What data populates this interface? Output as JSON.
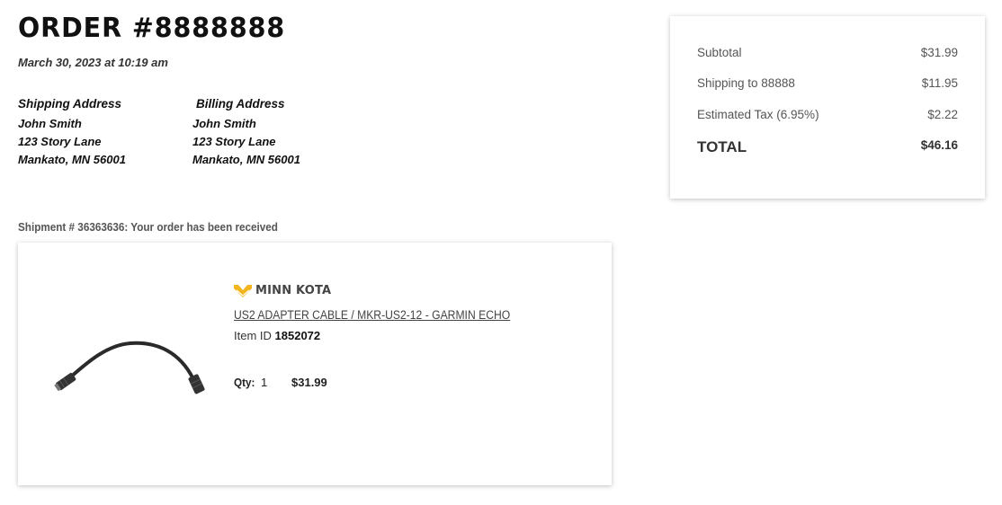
{
  "order": {
    "title": "ORDER #8888888",
    "date": "March 30, 2023 at 10:19 am"
  },
  "shipping_address": {
    "heading": "Shipping Address",
    "name": "John Smith",
    "street": "123 Story Lane",
    "city_state_zip": "Mankato, MN 56001"
  },
  "billing_address": {
    "heading": "Billing Address",
    "name": "John Smith",
    "street": "123 Story Lane",
    "city_state_zip": "Mankato, MN 56001"
  },
  "shipment": {
    "status_text": "Shipment # 36363636: Your order has been received",
    "item": {
      "brand": "MINN KOTA",
      "name": "US2 ADAPTER CABLE / MKR-US2-12 - GARMIN ECHO",
      "item_id_label": "Item ID",
      "item_id": "1852072",
      "qty_label": "Qty:",
      "qty": "1",
      "price": "$31.99",
      "image_icon": "cable-product-image"
    }
  },
  "summary": {
    "subtotal_label": "Subtotal",
    "subtotal": "$31.99",
    "shipping_label": "Shipping to 88888",
    "shipping": "$11.95",
    "tax_label": "Estimated Tax (6.95%)",
    "tax": "$2.22",
    "total_label": "TOTAL",
    "total": "$46.16"
  },
  "colors": {
    "brand_accent": "#f2b51c",
    "text_primary": "#111111",
    "text_muted": "#555555"
  }
}
